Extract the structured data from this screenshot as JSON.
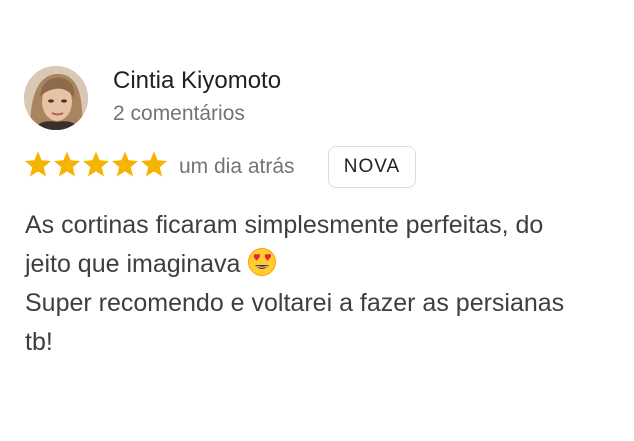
{
  "review": {
    "author": {
      "name": "Cintia Kiyomoto",
      "meta": "2 comentários",
      "avatar_icon": "profile-photo"
    },
    "rating": 5,
    "rating_max": 5,
    "star_color": "#f4b400",
    "date": "um dia atrás",
    "badge": "NOVA",
    "text": {
      "line1": "As cortinas ficaram simplesmente perfeitas, do",
      "line2": "jeito que imaginava",
      "line2_emoji": "heart-eyes-emoji",
      "line3": "Super recomendo e voltarei a fazer as persianas",
      "line4": "tb!"
    }
  }
}
